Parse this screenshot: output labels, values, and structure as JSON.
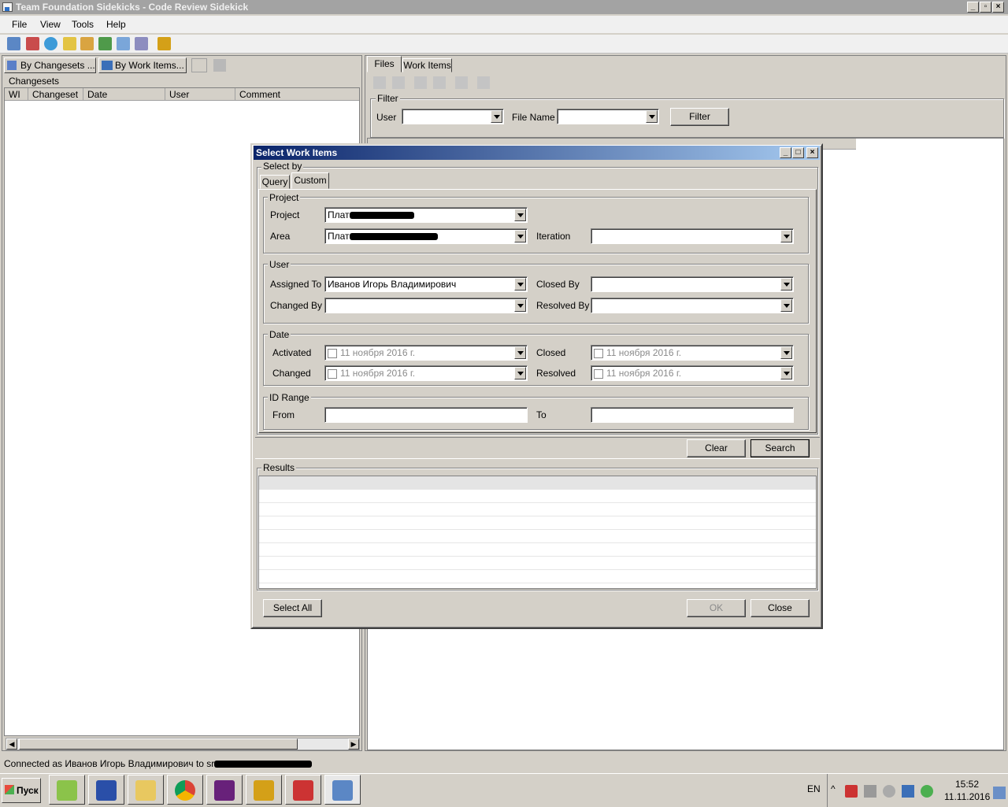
{
  "window": {
    "title": "Team Foundation Sidekicks - Code Review Sidekick",
    "min": "_",
    "max": "▫",
    "close": "×"
  },
  "menu": [
    "File",
    "View",
    "Tools",
    "Help"
  ],
  "left_pane": {
    "tab1": "By Changesets ...",
    "tab2": "By Work Items...",
    "group": "Changesets",
    "columns": [
      "WI",
      "Changeset",
      "Date",
      "User",
      "Comment"
    ]
  },
  "right_pane": {
    "tabs": [
      "Files",
      "Work Items"
    ],
    "filter_group": "Filter",
    "user_label": "User",
    "filename_label": "File Name",
    "filter_button": "Filter"
  },
  "dialog": {
    "title": "Select Work Items",
    "select_by": "Select by",
    "tabs": [
      "Query",
      "Custom"
    ],
    "project_group": "Project",
    "project_label": "Project",
    "project_value": "Плат",
    "area_label": "Area",
    "area_value": "Плат",
    "iteration_label": "Iteration",
    "user_group": "User",
    "assigned_label": "Assigned To",
    "assigned_value": "Иванов Игорь Владимирович",
    "closed_by_label": "Closed By",
    "changed_by_label": "Changed By",
    "resolved_by_label": "Resolved By",
    "date_group": "Date",
    "activated_label": "Activated",
    "closed_label": "Closed",
    "changed_label": "Changed",
    "resolved_label": "Resolved",
    "date_value": "11   ноября   2016 г.",
    "id_group": "ID Range",
    "from_label": "From",
    "to_label": "To",
    "clear_button": "Clear",
    "search_button": "Search",
    "results_group": "Results",
    "select_all_button": "Select All",
    "ok_button": "OK",
    "close_button": "Close"
  },
  "status": {
    "text": "Connected as Иванов Игорь Владимирович to sr"
  },
  "taskbar": {
    "start": "Пуск",
    "lang": "EN",
    "time": "15:52",
    "date": "11.11.2016"
  }
}
